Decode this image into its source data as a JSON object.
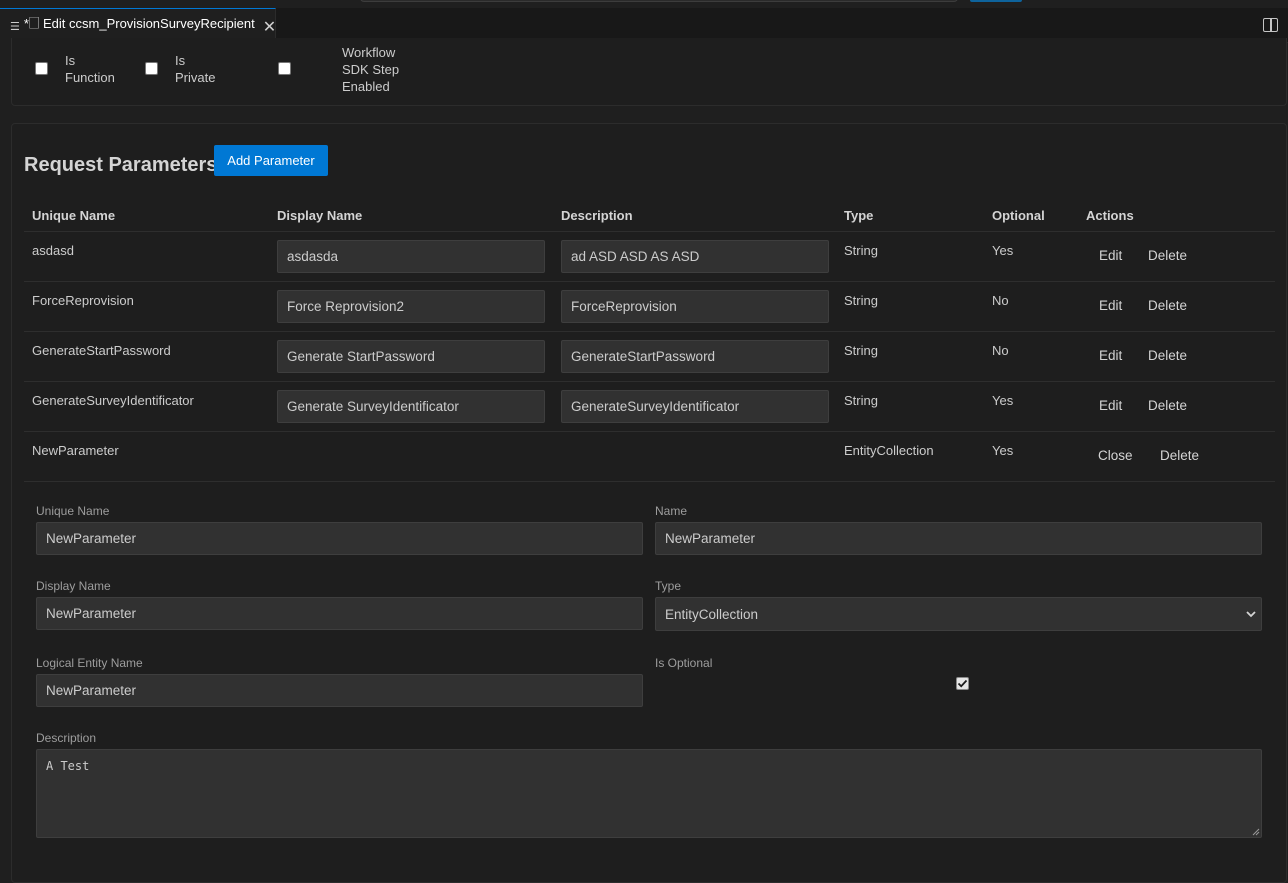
{
  "tab": {
    "title": "*🗌 Edit ccsm_ProvisionSurveyRecipient",
    "close": "✕"
  },
  "flags": [
    {
      "label": "Is\nFunction",
      "checked": false
    },
    {
      "label": "Is\nPrivate",
      "checked": false
    },
    {
      "label": "Workflow\nSDK Step\nEnabled",
      "checked": false
    }
  ],
  "request": {
    "title": "Request Parameters",
    "add_button": "Add Parameter",
    "columns": [
      "Unique Name",
      "Display Name",
      "Description",
      "Type",
      "Optional",
      "Actions"
    ],
    "rows": [
      {
        "unique": "asdasd",
        "display": "asdasda",
        "description": "ad ASD ASD AS ASD",
        "type": "String",
        "optional": "Yes",
        "edit": "Edit",
        "delete": "Delete"
      },
      {
        "unique": "ForceReprovision",
        "display": "Force Reprovision2",
        "description": "ForceReprovision",
        "type": "String",
        "optional": "No",
        "edit": "Edit",
        "delete": "Delete"
      },
      {
        "unique": "GenerateStartPassword",
        "display": "Generate StartPassword",
        "description": "GenerateStartPassword",
        "type": "String",
        "optional": "No",
        "edit": "Edit",
        "delete": "Delete"
      },
      {
        "unique": "GenerateSurveyIdentificator",
        "display": "Generate SurveyIdentificator",
        "description": "GenerateSurveyIdentificator",
        "type": "String",
        "optional": "Yes",
        "edit": "Edit",
        "delete": "Delete"
      }
    ],
    "new_row": {
      "unique": "NewParameter",
      "type": "EntityCollection",
      "optional": "Yes",
      "close": "Close",
      "delete": "Delete"
    }
  },
  "form": {
    "unique_name": {
      "label": "Unique Name",
      "value": "NewParameter"
    },
    "name": {
      "label": "Name",
      "value": "NewParameter"
    },
    "display_name": {
      "label": "Display Name",
      "value": "NewParameter"
    },
    "type": {
      "label": "Type",
      "value": "EntityCollection"
    },
    "logical_entity_name": {
      "label": "Logical Entity Name",
      "value": "NewParameter"
    },
    "is_optional": {
      "label": "Is Optional",
      "checked": true
    },
    "description": {
      "label": "Description",
      "value": "A Test"
    }
  }
}
